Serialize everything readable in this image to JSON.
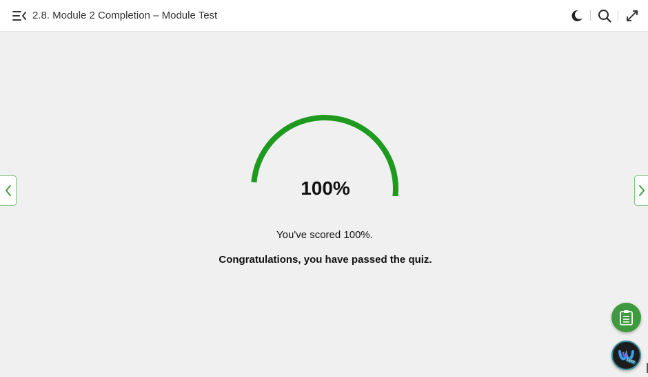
{
  "header": {
    "title": "2.8. Module 2 Completion – Module Test",
    "icons": [
      "menu-collapse-icon",
      "moon-icon",
      "search-icon",
      "expand-icon"
    ]
  },
  "quiz_result": {
    "score_percent": 100,
    "score_label": "100%",
    "scored_message": "You've scored 100%.",
    "result_message": "Congratulations, you have passed the quiz."
  },
  "widgets": {
    "webex_badge": "beta"
  },
  "colors": {
    "gauge_green": "#1e9a1e",
    "nav_border": "#7cc47c",
    "fab_green": "#3f9a3f",
    "background": "#f0f0f0"
  }
}
